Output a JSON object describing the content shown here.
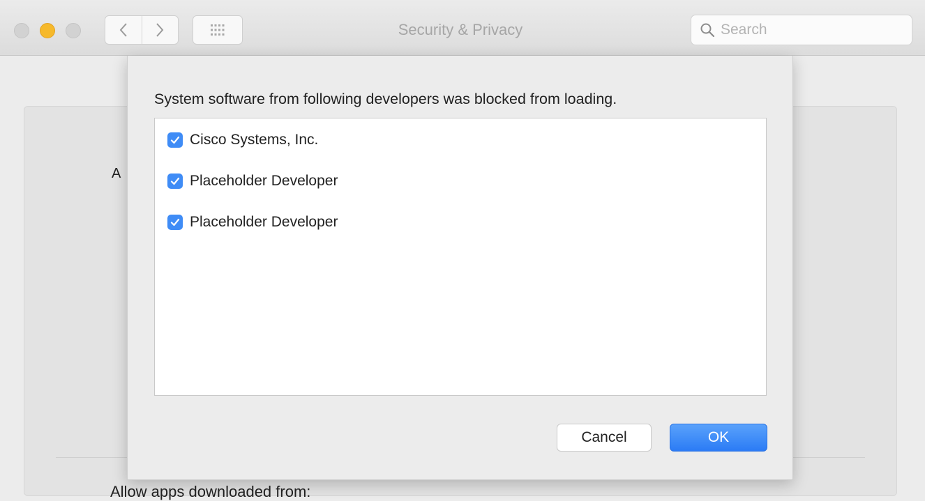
{
  "window": {
    "title": "Security & Privacy",
    "search_placeholder": "Search"
  },
  "background": {
    "partial_letter": "A",
    "bottom_text": "Allow apps downloaded from:"
  },
  "dialog": {
    "message": "System software from following developers was blocked from loading.",
    "developers": [
      {
        "label": "Cisco Systems, Inc.",
        "checked": true
      },
      {
        "label": "Placeholder Developer",
        "checked": true
      },
      {
        "label": "Placeholder Developer",
        "checked": true
      }
    ],
    "cancel_label": "Cancel",
    "ok_label": "OK"
  },
  "colors": {
    "accent": "#3f8cf6",
    "minimize": "#f6b92b"
  },
  "icons": {
    "back": "chevron-left-icon",
    "forward": "chevron-right-icon",
    "show_all": "grid-icon",
    "search": "search-icon",
    "checkbox": "checkmark-icon"
  }
}
